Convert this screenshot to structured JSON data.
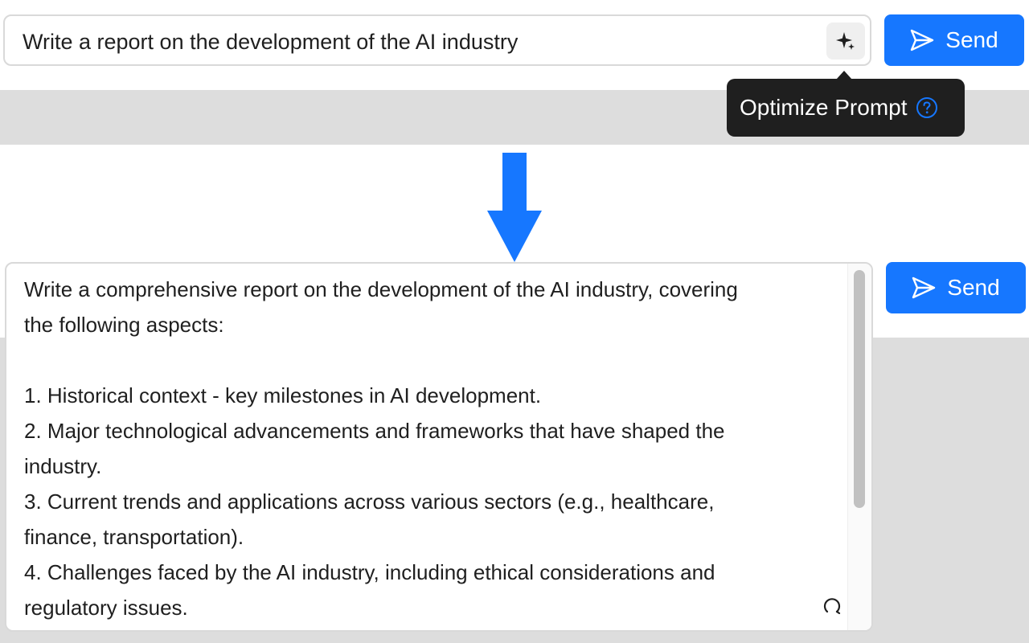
{
  "top_prompt": {
    "value": "Write a report on the development of the AI industry",
    "optimize_icon": "sparkle-icon"
  },
  "send": {
    "label": "Send",
    "icon": "send-icon",
    "color": "#1677ff"
  },
  "tooltip": {
    "label": "Optimize Prompt",
    "help_icon": "question-circle-icon"
  },
  "transition_arrow": {
    "icon": "arrow-down-icon",
    "color": "#1677ff"
  },
  "optimized_prompt": {
    "lines": [
      "Write a comprehensive report on the development of the AI industry, covering",
      "the following aspects:",
      "",
      "1. Historical context - key milestones in AI development.",
      "2. Major technological advancements and frameworks that have shaped the",
      "industry.",
      "3. Current trends and applications across various sectors (e.g., healthcare,",
      "finance, transportation).",
      "4. Challenges faced by the AI industry, including ethical considerations and",
      "regulatory issues."
    ],
    "loading_icon": "spinner-icon"
  }
}
